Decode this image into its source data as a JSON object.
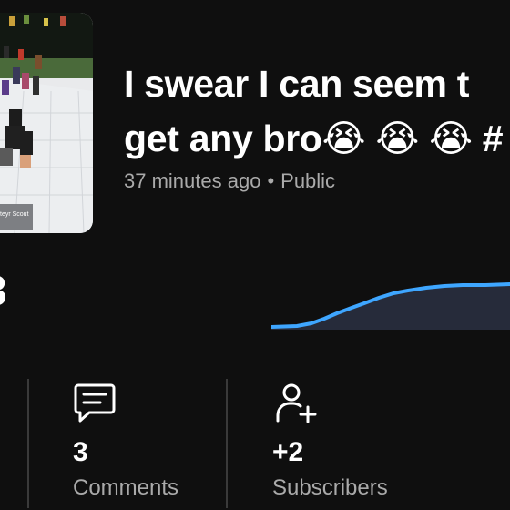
{
  "video": {
    "title_line1": "I swear I can seem t",
    "title_line2": "get any bro😭 😭 😭 #",
    "time_ago": "37 minutes ago",
    "separator": "•",
    "visibility": "Public",
    "thumbnail_caption": "teyr Scout"
  },
  "views_partial": "3",
  "stats": {
    "comments": {
      "value": "3",
      "label": "Comments",
      "icon": "comment-icon"
    },
    "subscribers": {
      "value": "+2",
      "label": "Subscribers",
      "icon": "add-person-icon"
    }
  },
  "colors": {
    "background": "#0f0f0f",
    "chart_line": "#3ea6ff",
    "chart_fill": "#262b3a",
    "secondary_text": "#aaaaaa",
    "divider": "#3a3a3a"
  }
}
